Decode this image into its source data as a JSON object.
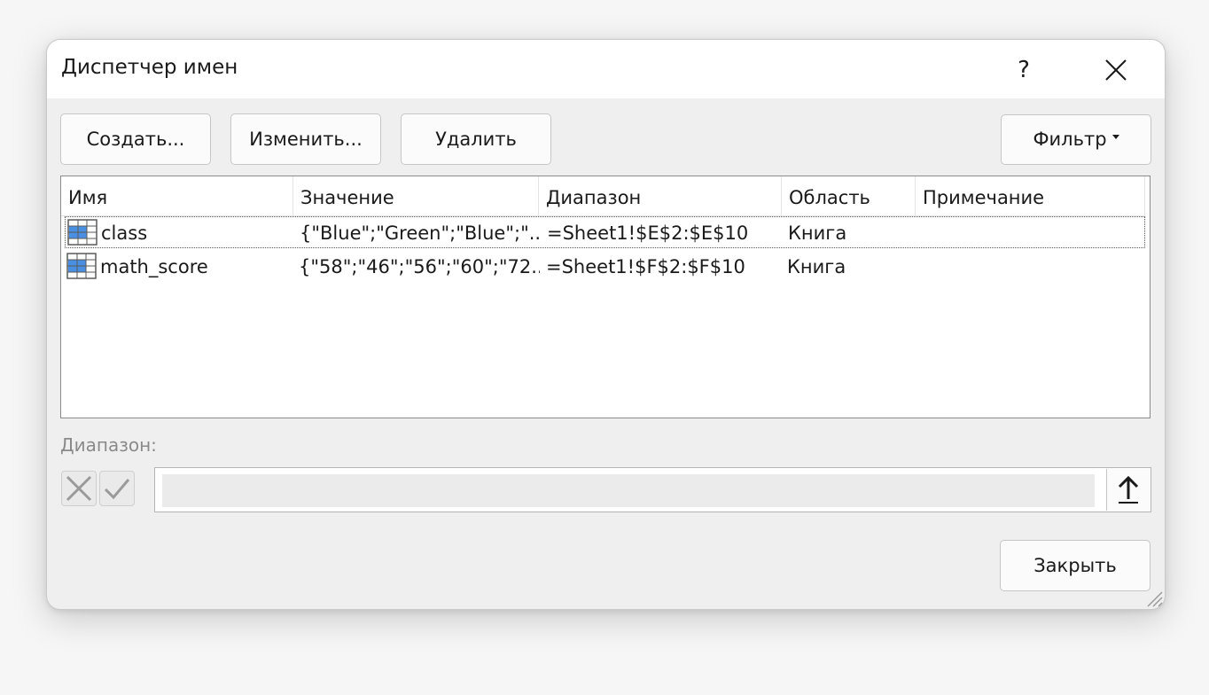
{
  "window": {
    "title": "Диспетчер имен",
    "help_label": "?"
  },
  "toolbar": {
    "create_label": "Создать...",
    "edit_label": "Изменить...",
    "delete_label": "Удалить",
    "filter_label": "Фильтр"
  },
  "list": {
    "columns": [
      "Имя",
      "Значение",
      "Диапазон",
      "Область",
      "Примечание"
    ],
    "rows": [
      {
        "name": "class",
        "value": "{\"Blue\";\"Green\";\"Blue\";\"...",
        "range": "=Sheet1!$E$2:$E$10",
        "scope": "Книга",
        "comment": "",
        "selected": true
      },
      {
        "name": "math_score",
        "value": "{\"58\";\"46\";\"56\";\"60\";\"72...",
        "range": "=Sheet1!$F$2:$F$10",
        "scope": "Книга",
        "comment": "",
        "selected": false
      }
    ]
  },
  "refers_to": {
    "label": "Диапазон:",
    "value": ""
  },
  "footer": {
    "close_label": "Закрыть"
  },
  "colors": {
    "table_icon_fill": "#4a90e2",
    "accent": "#1a1a1a"
  }
}
